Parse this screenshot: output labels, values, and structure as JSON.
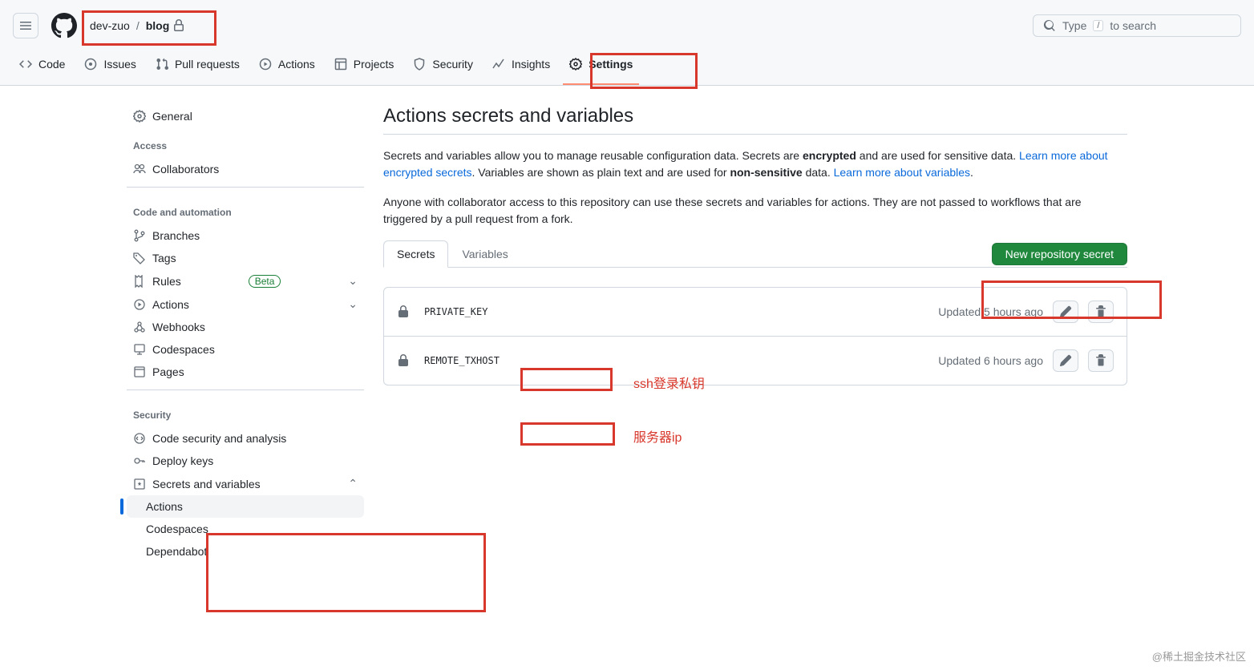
{
  "header": {
    "owner": "dev-zuo",
    "repo": "blog",
    "search": {
      "prefix": "Type",
      "key": "/",
      "suffix": "to search"
    }
  },
  "nav": {
    "code": "Code",
    "issues": "Issues",
    "pulls": "Pull requests",
    "actions": "Actions",
    "projects": "Projects",
    "security": "Security",
    "insights": "Insights",
    "settings": "Settings"
  },
  "sidebar": {
    "general": "General",
    "access": "Access",
    "collaborators": "Collaborators",
    "code_auto": "Code and automation",
    "branches": "Branches",
    "tags": "Tags",
    "rules": "Rules",
    "rules_badge": "Beta",
    "actions": "Actions",
    "webhooks": "Webhooks",
    "codespaces": "Codespaces",
    "pages": "Pages",
    "security": "Security",
    "code_sec": "Code security and analysis",
    "deploy_keys": "Deploy keys",
    "secrets_vars": "Secrets and variables",
    "sv_actions": "Actions",
    "sv_codespaces": "Codespaces",
    "sv_dependabot": "Dependabot"
  },
  "page": {
    "title": "Actions secrets and variables",
    "desc1_a": "Secrets and variables allow you to manage reusable configuration data. Secrets are ",
    "desc1_b": "encrypted",
    "desc1_c": " and are used for sensitive data. ",
    "desc1_link1": "Learn more about encrypted secrets",
    "desc1_d": ". Variables are shown as plain text and are used for ",
    "desc1_e": "non-sensitive",
    "desc1_f": " data. ",
    "desc1_link2": "Learn more about variables",
    "desc1_g": ".",
    "desc2": "Anyone with collaborator access to this repository can use these secrets and variables for actions. They are not passed to workflows that are triggered by a pull request from a fork.",
    "tab_secrets": "Secrets",
    "tab_variables": "Variables",
    "new_secret": "New repository secret",
    "secrets": [
      {
        "name": "PRIVATE_KEY",
        "updated": "Updated 5 hours ago",
        "annot": "ssh登录私钥"
      },
      {
        "name": "REMOTE_TXHOST",
        "updated": "Updated 6 hours ago",
        "annot": "服务器ip"
      }
    ]
  },
  "watermark": "@稀土掘金技术社区"
}
